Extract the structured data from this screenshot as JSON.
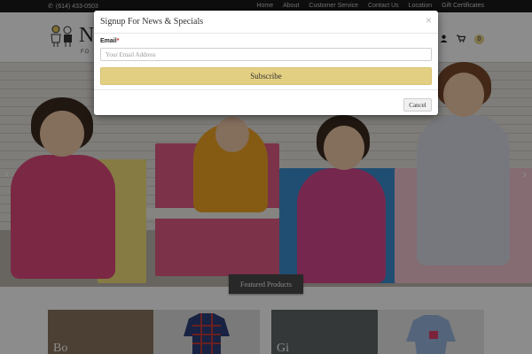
{
  "topbar": {
    "phone": "(614) 433-0503",
    "nav": [
      "Home",
      "About",
      "Customer Service",
      "Contact Us",
      "Location",
      "Gift Certificates"
    ]
  },
  "header": {
    "logo_text": "N",
    "logo_subtext": "FO",
    "cart_count": "0"
  },
  "featured": {
    "ribbon_label": "Featured Products",
    "tiles": [
      {
        "label": "Bo"
      },
      {
        "label": ""
      },
      {
        "label": "Gi"
      },
      {
        "label": ""
      }
    ]
  },
  "modal": {
    "title": "Signup For News & Specials",
    "close_glyph": "×",
    "email_label": "Email",
    "required_mark": "*",
    "email_placeholder": "Your Email Address",
    "email_value": "",
    "subscribe_label": "Subscribe",
    "cancel_label": "Cancel"
  },
  "icons": {
    "phone": "phone-icon",
    "user": "user-icon",
    "cart": "cart-icon",
    "close": "close-icon",
    "prev": "chevron-left-icon",
    "next": "chevron-right-icon"
  },
  "colors": {
    "topbar_bg": "#1b1b1b",
    "accent_gold": "#e3cf82",
    "ribbon_bg": "#4a4a4a",
    "overlay": "rgba(0,0,0,0.45)"
  }
}
